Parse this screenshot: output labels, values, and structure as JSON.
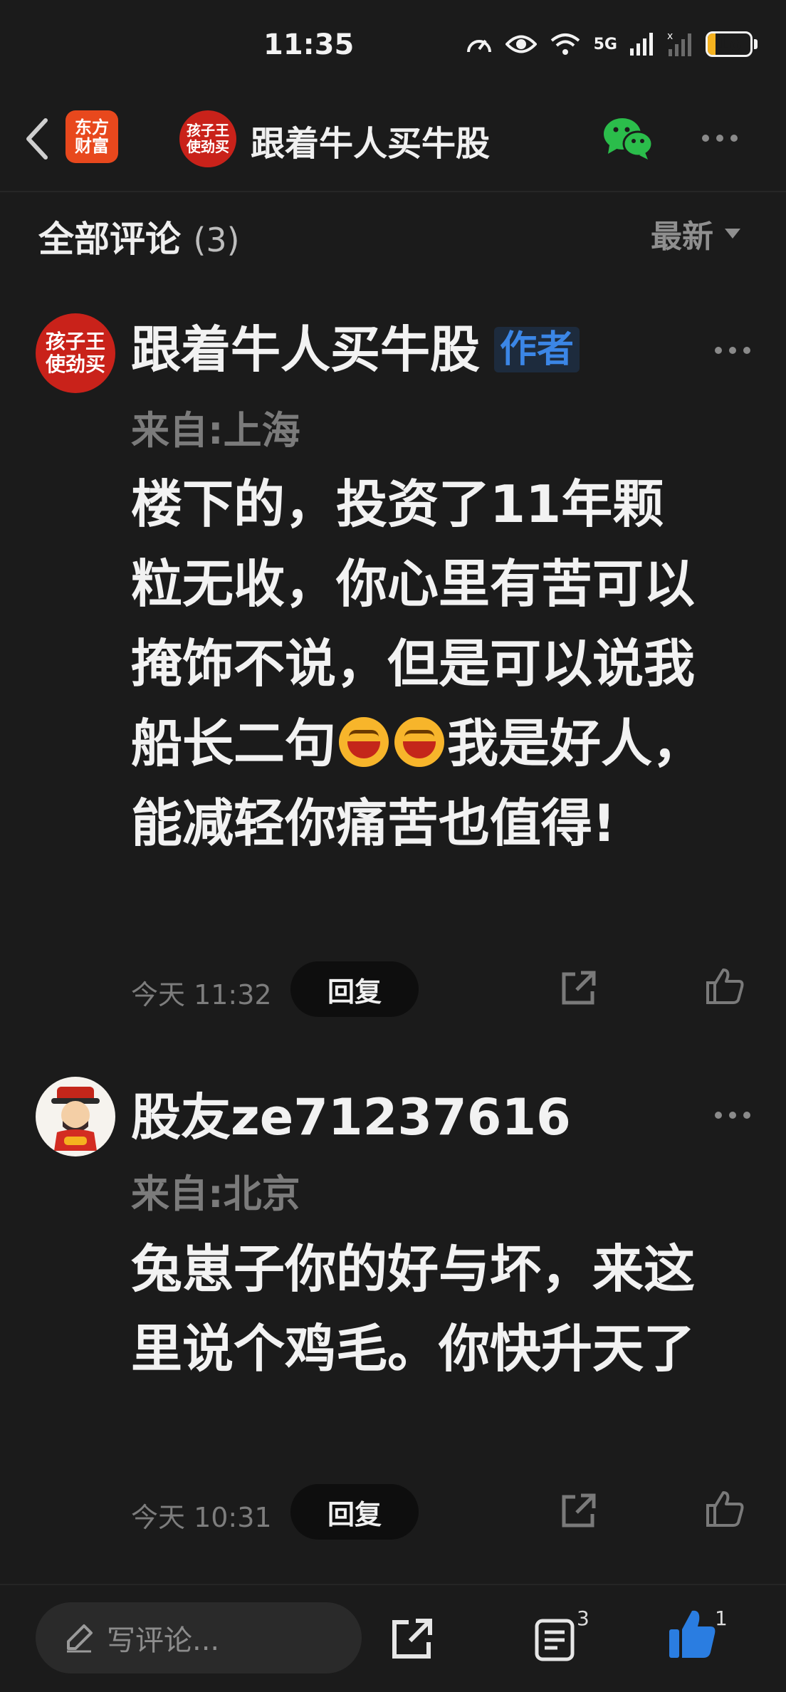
{
  "status_bar": {
    "time": "11:35",
    "network": "5G",
    "battery": "18",
    "battery_level": 0.18,
    "battery_color": "#f5b21f"
  },
  "nav": {
    "back_icon": "chevron-left-icon",
    "app_logo_line1": "东方",
    "app_logo_line2": "财富",
    "avatar_line1": "孩子王",
    "avatar_line2": "使劲买",
    "title": "跟着牛人买牛股",
    "share_icon": "wechat-icon",
    "more_icon": "more-horizontal-icon"
  },
  "comments_header": {
    "title": "全部评论",
    "count": "(3)",
    "sort_label": "最新"
  },
  "comments": [
    {
      "avatar_line1": "孩子王",
      "avatar_line2": "使劲买",
      "username": "跟着牛人买牛股",
      "badge": "作者",
      "location": "来自:上海",
      "text_before": "楼下的，投资了11年颗粒无收，你心里有苦可以掩饰不说，但是可以说我船长二句",
      "text_after": "我是好人，能减轻你痛苦也值得!",
      "emoji": "laughing-emoji-icon",
      "timestamp": "今天 11:32",
      "reply_label": "回复"
    },
    {
      "avatar_icon": "caishen-avatar-icon",
      "username": "股友ze71237616",
      "location": "来自:北京",
      "text": "兔崽子你的好与坏，来这里说个鸡毛。你快升天了",
      "timestamp": "今天 10:31",
      "reply_label": "回复"
    }
  ],
  "bottom_bar": {
    "input_placeholder": "写评论...",
    "comments_count": "3",
    "likes_count": "1",
    "like_color": "#2a7de1"
  }
}
